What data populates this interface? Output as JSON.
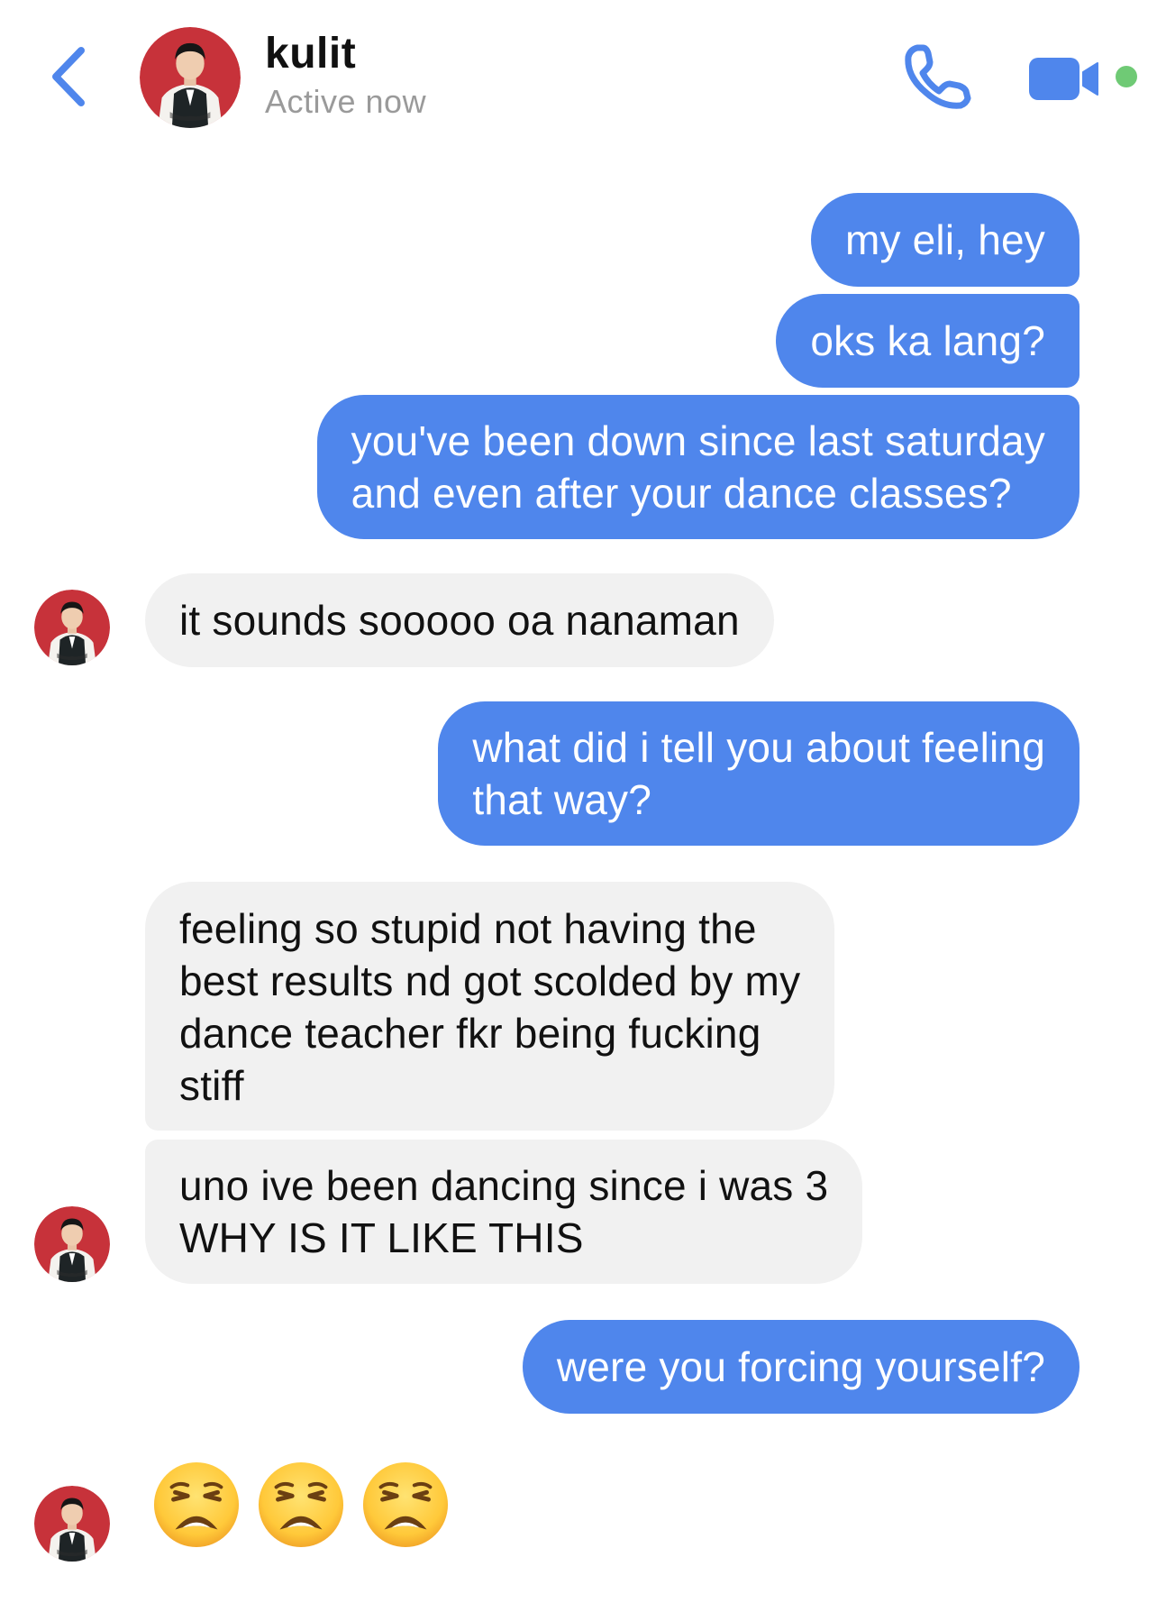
{
  "header": {
    "contact_name": "kulit",
    "status": "Active now",
    "back_icon": "chevron-left-icon",
    "call_icon": "phone-icon",
    "video_icon": "video-camera-icon",
    "online_color": "#6fca75",
    "accent_color": "#4f86ec"
  },
  "messages": [
    {
      "from": "me",
      "lines": [
        "my eli, hey"
      ]
    },
    {
      "from": "me",
      "lines": [
        "oks ka lang?"
      ]
    },
    {
      "from": "me",
      "lines": [
        "you've been down since last saturday",
        "and even after your dance classes?"
      ]
    },
    {
      "from": "them",
      "lines": [
        "it sounds sooooo oa nanaman"
      ]
    },
    {
      "from": "me",
      "lines": [
        "what did i tell you about feeling",
        "that way?"
      ]
    },
    {
      "from": "them",
      "lines": [
        "feeling so stupid not having the",
        "best results nd got scolded by my",
        "dance teacher fkr being fucking",
        "stiff"
      ]
    },
    {
      "from": "them",
      "lines": [
        "uno ive been dancing since i was 3",
        "WHY IS IT LIKE THIS"
      ]
    },
    {
      "from": "me",
      "lines": [
        "were you forcing yourself?"
      ]
    },
    {
      "from": "them",
      "emoji": [
        "weary-face",
        "weary-face",
        "weary-face"
      ]
    }
  ],
  "colors": {
    "outgoing_bubble": "#4f86ec",
    "incoming_bubble": "#f1f1f1"
  }
}
